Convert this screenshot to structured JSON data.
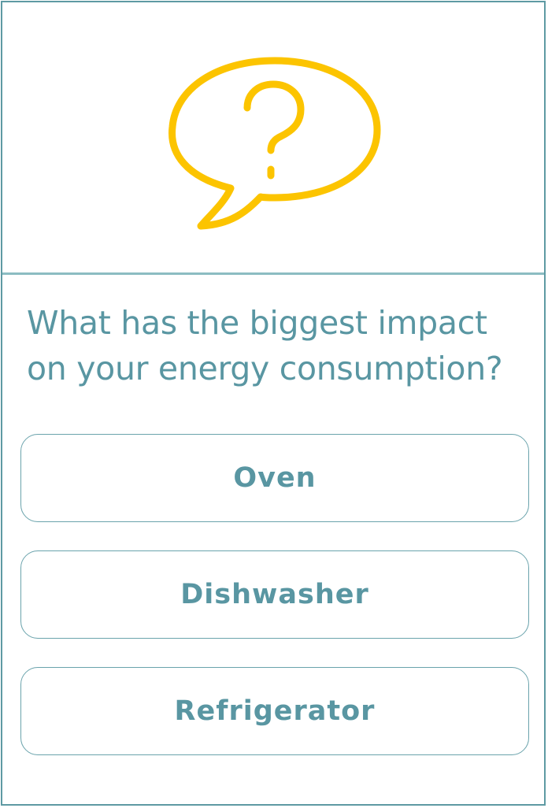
{
  "icon": {
    "name": "question-speech-bubble-icon",
    "color": "#fcc400"
  },
  "question": {
    "text": "What has the biggest impact on your energy consumption?"
  },
  "answers": [
    {
      "label": "Oven"
    },
    {
      "label": "Dishwasher"
    },
    {
      "label": "Refrigerator"
    }
  ],
  "colors": {
    "text": "#5996a2",
    "border": "#5e9aa3",
    "divider": "#8cbcc2",
    "icon": "#fcc400"
  }
}
